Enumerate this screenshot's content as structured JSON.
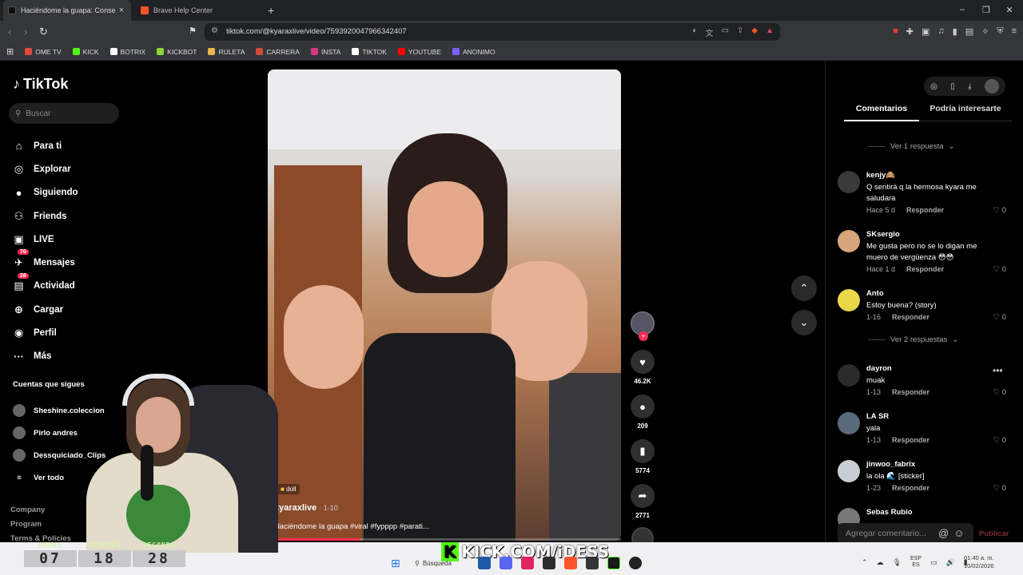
{
  "browser": {
    "tabs": [
      {
        "label": "Haciéndome la guapa: Conse",
        "active": true
      },
      {
        "label": "Brave Help Center",
        "active": false
      }
    ],
    "url": "tiktok.com/@kyaraxlive/video/7593920047966342407",
    "bookmarks": [
      {
        "label": "OME TV",
        "color": "#e04a3a"
      },
      {
        "label": "KICK",
        "color": "#53fc18"
      },
      {
        "label": "BOTRIX",
        "color": "#ffffff"
      },
      {
        "label": "KICKBOT",
        "color": "#8bd437"
      },
      {
        "label": "RULETA",
        "color": "#e8b84a"
      },
      {
        "label": "CARRERA",
        "color": "#d44a3a"
      },
      {
        "label": "INSTA",
        "color": "#d6387e"
      },
      {
        "label": "TIKTOK",
        "color": "#ffffff"
      },
      {
        "label": "YOUTUBE",
        "color": "#ff0000"
      },
      {
        "label": "ANONIMO",
        "color": "#7b61ff"
      }
    ]
  },
  "tiktok": {
    "logo": "TikTok",
    "search_placeholder": "Buscar",
    "menu": [
      {
        "label": "Para ti",
        "icon": "home-icon"
      },
      {
        "label": "Explorar",
        "icon": "compass-icon"
      },
      {
        "label": "Siguiendo",
        "icon": "following-icon"
      },
      {
        "label": "Friends",
        "icon": "friends-icon"
      },
      {
        "label": "LIVE",
        "icon": "live-icon"
      },
      {
        "label": "Mensajes",
        "icon": "messages-icon",
        "badge": "70"
      },
      {
        "label": "Actividad",
        "icon": "activity-icon",
        "badge": "28"
      },
      {
        "label": "Cargar",
        "icon": "upload-icon"
      },
      {
        "label": "Perfil",
        "icon": "profile-icon"
      },
      {
        "label": "Más",
        "icon": "more-icon"
      }
    ],
    "following_title": "Cuentas que sigues",
    "following": [
      "Sheshine.coleccion",
      "Pirlo andres",
      "Dessquiciado_Clips"
    ],
    "see_all": "Ver todo",
    "footer": [
      "Company",
      "Program",
      "Terms & Policies"
    ]
  },
  "video": {
    "tag": "doll",
    "author": "kyaraxlive",
    "date": "· 1-10",
    "caption": "Haciéndome la guapa #viral #fypppp #parati...",
    "progress": 0.26,
    "likes": "46.2K",
    "comments": "209",
    "saves": "5774",
    "shares": "2771"
  },
  "panel": {
    "tabs": [
      "Comentarios",
      "Podría interesarte"
    ],
    "replies_1": "Ver 1 respuesta",
    "replies_2": "Ver 2 respuestas",
    "reply_label": "Responder",
    "comments": [
      {
        "user": "kenjy🙈",
        "text": "Q sentirá q la hermosa kyara me saludara",
        "date": "Hace 5 d",
        "likes": "0"
      },
      {
        "user": "SKsergio",
        "text": "Me gusta pero no se lo digan me muero de vergüenza 😳😳",
        "date": "Hace 1 d",
        "likes": "0"
      },
      {
        "user": "Anto",
        "text": "Estoy buena? (story)",
        "date": "1-16",
        "likes": "0"
      },
      {
        "user": "dayron",
        "text": "muak",
        "date": "1-13",
        "likes": "0"
      },
      {
        "user": "LA SR",
        "text": "yala",
        "date": "1-13",
        "likes": "0"
      },
      {
        "user": "jinwoo_fabrix",
        "text": "la ola 🌊 [sticker]",
        "date": "1-23",
        "likes": "0"
      },
      {
        "user": "Sebas Rubio",
        "text": "",
        "date": "",
        "likes": ""
      }
    ],
    "add_comment_placeholder": "Agregar comentario...",
    "publish": "Publicar"
  },
  "overlay": {
    "timer": [
      {
        "label": "HOURS",
        "value": "07"
      },
      {
        "label": "MINUTES",
        "value": "18"
      },
      {
        "label": "SECONDS",
        "value": "28"
      }
    ],
    "kick_url": "KICK.COM/iDESS"
  },
  "taskbar": {
    "search": "Búsqueda",
    "lang": "ESP",
    "lang_sub": "ES",
    "time": "01:40 a. m.",
    "date": "10/02/2026"
  }
}
